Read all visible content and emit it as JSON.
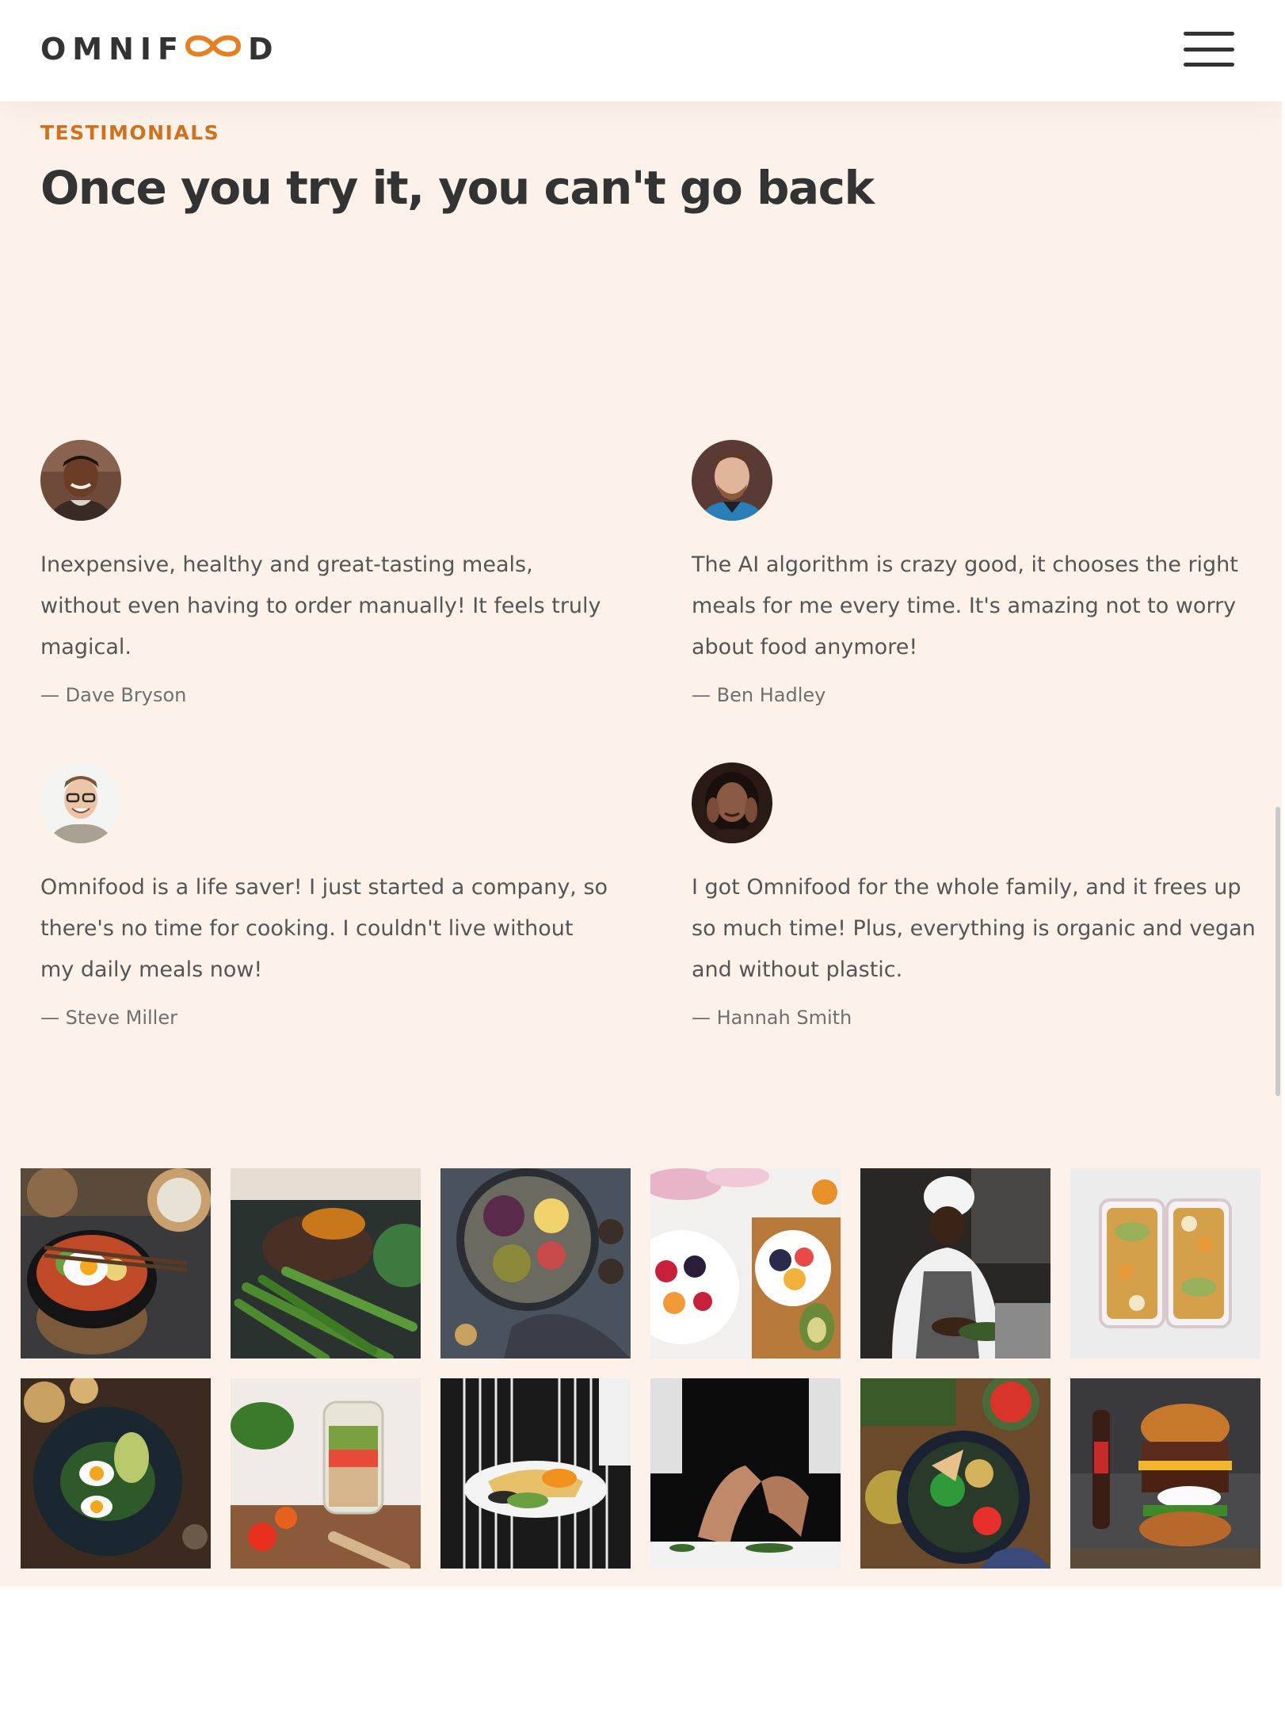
{
  "header": {
    "logo_left": "OMNIF",
    "logo_right": "D",
    "menu_icon": "hamburger-menu-icon"
  },
  "testimonials_section": {
    "subheading": "Testimonials",
    "heading": "Once you try it, you can't go back",
    "items": [
      {
        "quote": "Inexpensive, healthy and great-tasting meals, without even having to order manually! It feels truly magical.",
        "author": "— Dave Bryson"
      },
      {
        "quote": "The AI algorithm is crazy good, it chooses the right meals for me every time. It's amazing not to worry about food anymore!",
        "author": "— Ben Hadley"
      },
      {
        "quote": "Omnifood is a life saver! I just started a company, so there's no time for cooking. I couldn't live without my daily meals now!",
        "author": "— Steve Miller"
      },
      {
        "quote": "I got Omnifood for the whole family, and it frees up so much time! Plus, everything is organic and vegan and without plastic.",
        "author": "— Hannah Smith"
      }
    ]
  },
  "colors": {
    "accent": "#e67e22",
    "accent_dark": "#cf711f",
    "section_background": "#fcf2ea",
    "heading": "#333333",
    "text": "#555555"
  }
}
